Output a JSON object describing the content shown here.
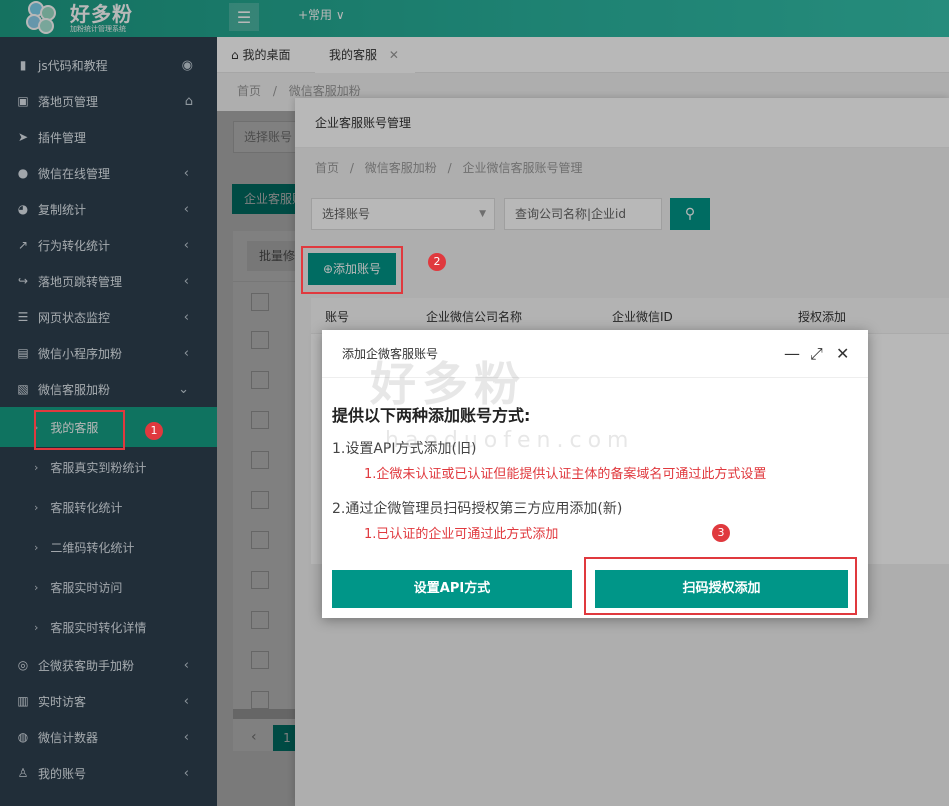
{
  "app": {
    "name": "好多粉",
    "subtitle": "加粉统计管理系统",
    "top_menu": "+常用 ∨"
  },
  "sidebar": {
    "items": [
      {
        "label": "js代码和教程",
        "icon": "bookmark-icon",
        "right_icon": "eye-icon"
      },
      {
        "label": "落地页管理",
        "icon": "document-icon",
        "right_icon": "home-icon"
      },
      {
        "label": "插件管理",
        "icon": "paper-plane-icon"
      },
      {
        "label": "微信在线管理",
        "icon": "wechat-icon"
      },
      {
        "label": "复制统计",
        "icon": "pie-chart-icon"
      },
      {
        "label": "行为转化统计",
        "icon": "line-chart-icon"
      },
      {
        "label": "落地页跳转管理",
        "icon": "share-icon"
      },
      {
        "label": "网页状态监控",
        "icon": "list-icon"
      },
      {
        "label": "微信小程序加粉",
        "icon": "image-icon"
      },
      {
        "label": "微信客服加粉",
        "icon": "picture-icon"
      }
    ],
    "sub_items": [
      "我的客服",
      "客服真实到粉统计",
      "客服转化统计",
      "二维码转化统计",
      "客服实时访问",
      "客服实时转化详情"
    ],
    "bottom_items": [
      {
        "label": "企微获客助手加粉",
        "icon": "headset-icon"
      },
      {
        "label": "实时访客",
        "icon": "bar-chart-icon"
      },
      {
        "label": "微信计数器",
        "icon": "chat-icon"
      },
      {
        "label": "我的账号",
        "icon": "user-icon"
      }
    ]
  },
  "tabs": {
    "home": "我的桌面",
    "current": "我的客服",
    "close": "✕"
  },
  "breadcrumb": {
    "home": "首页",
    "sep": "/",
    "current": "微信客服加粉"
  },
  "bg": {
    "select_placeholder": "选择账号",
    "button": "企业客服账",
    "batch": "批量修",
    "page_num": "1"
  },
  "layer1": {
    "title": "企业客服账号管理",
    "crumb": [
      "首页",
      "微信客服加粉",
      "企业微信客服账号管理"
    ],
    "select_placeholder": "选择账号",
    "search_placeholder": "查询公司名称|企业id",
    "add_button": "添加账号",
    "columns": [
      "账号",
      "企业微信公司名称",
      "企业微信ID",
      "授权添加"
    ]
  },
  "dialog": {
    "title": "添加企微客服账号",
    "heading": "提供以下两种添加账号方式:",
    "method1": "1.设置API方式添加(旧)",
    "method1_note": "1.企微未认证或已认证但能提供认证主体的备案域名可通过此方式设置",
    "method2": "2.通过企微管理员扫码授权第三方应用添加(新)",
    "method2_note": "1.已认证的企业可通过此方式添加",
    "btn_api": "设置API方式",
    "btn_scan": "扫码授权添加",
    "watermark": "好多粉",
    "watermark_url": "haoduofen.com"
  },
  "annotations": {
    "n1": "1",
    "n2": "2",
    "n3": "3"
  },
  "colors": {
    "accent": "#009688",
    "sidebar": "#2f4050",
    "active_sub": "#16a085",
    "annotation": "#e0393e"
  }
}
